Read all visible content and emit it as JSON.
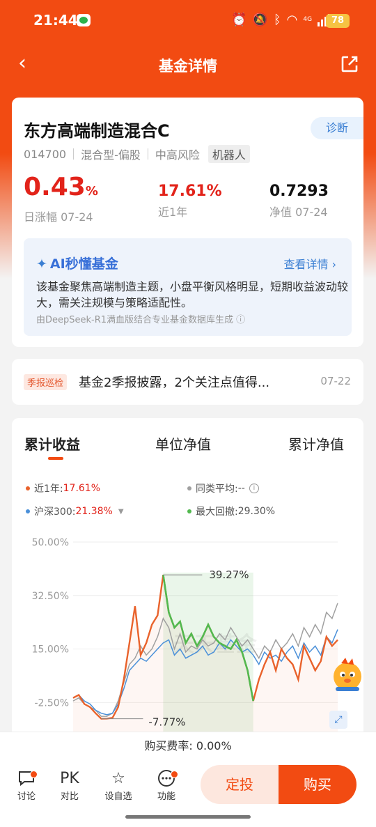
{
  "status": {
    "time": "21:44",
    "network": "4G",
    "battery": "78"
  },
  "nav": {
    "title": "基金详情"
  },
  "fund": {
    "name": "东方高端制造混合C",
    "diagnose_label": "诊断",
    "code": "014700",
    "type": "混合型-偏股",
    "risk": "中高风险",
    "robot_tag": "机器人",
    "daily_change_value": "0.43",
    "daily_change_unit": "%",
    "daily_change_label": "日涨幅 07-24",
    "year_return": "17.61%",
    "year_return_label": "近1年",
    "nav_value": "0.7293",
    "nav_label": "净值 07-24"
  },
  "ai": {
    "title": "AI秒懂基金",
    "link": "查看详情",
    "text": "该基金聚焦高端制造主题，小盘平衡风格明显，短期收益波动较大，需关注规模与策略适配性。",
    "source": "由DeepSeek-R1满血版结合专业基金数据库生成"
  },
  "notice": {
    "tag": "季报巡检",
    "text": "基金2季报披露，2个关注点值得...",
    "date": "07-22"
  },
  "tabs": [
    "累计收益",
    "单位净值",
    "累计净值"
  ],
  "legend": {
    "fund_label": "近1年:",
    "fund_value": "17.61%",
    "peer_label": "同类平均:",
    "peer_value": "--",
    "index_label": "沪深300:",
    "index_value": "21.38%",
    "drawdown_label": "最大回撤:",
    "drawdown_value": "29.30%"
  },
  "colors": {
    "fund": "#e9622b",
    "peer": "#a0a0a0",
    "index": "#4a90d9",
    "drawdown": "#52b94f"
  },
  "chart_data": {
    "type": "line",
    "y_ticks": [
      "50.00%",
      "32.50%",
      "15.00%",
      "-2.50%"
    ],
    "ylim": [
      -12,
      50
    ],
    "max_label": "39.27%",
    "min_label": "-7.77%",
    "watermark": "天天基金",
    "series": [
      {
        "name": "近1年",
        "values": [
          -1,
          0,
          -3,
          -4,
          -6,
          -7.8,
          -7.77,
          -7.5,
          -4,
          5,
          17,
          29,
          13,
          17,
          23,
          26,
          39.27,
          27,
          22,
          24,
          17,
          20,
          16,
          19,
          23,
          19,
          17,
          16,
          15,
          18,
          14,
          8,
          -2,
          5,
          10,
          14,
          8,
          15,
          12,
          10,
          5,
          16,
          12,
          8,
          11,
          19,
          16,
          18
        ]
      },
      {
        "name": "沪深300",
        "values": [
          -1,
          0,
          -2,
          -3,
          -5,
          -6,
          -6.5,
          -6,
          -3,
          2,
          8,
          10,
          12,
          11,
          13,
          15,
          17,
          18,
          13,
          15,
          12,
          13,
          14,
          16,
          13,
          14,
          17,
          15,
          18,
          16,
          14,
          15,
          13,
          10,
          14,
          12,
          13,
          11,
          14,
          16,
          12,
          17,
          14,
          16,
          13,
          19,
          17,
          21.38
        ]
      },
      {
        "name": "同类平均",
        "values": [
          -2,
          -1,
          -3,
          -4,
          -5,
          -7,
          -7,
          -6,
          -2,
          4,
          10,
          12,
          16,
          13,
          15,
          19,
          25,
          22,
          15,
          20,
          14,
          16,
          15,
          18,
          16,
          17,
          20,
          18,
          22,
          19,
          16,
          18,
          15,
          12,
          16,
          14,
          18,
          15,
          17,
          20,
          16,
          22,
          19,
          23,
          20,
          27,
          25,
          30
        ]
      }
    ]
  },
  "fee": {
    "text": "购买费率: 0.00%"
  },
  "bottom": {
    "discuss": "讨论",
    "compare_icon": "PK",
    "compare": "对比",
    "watchlist": "设自选",
    "functions": "功能",
    "dingtou": "定投",
    "buy": "购买"
  }
}
